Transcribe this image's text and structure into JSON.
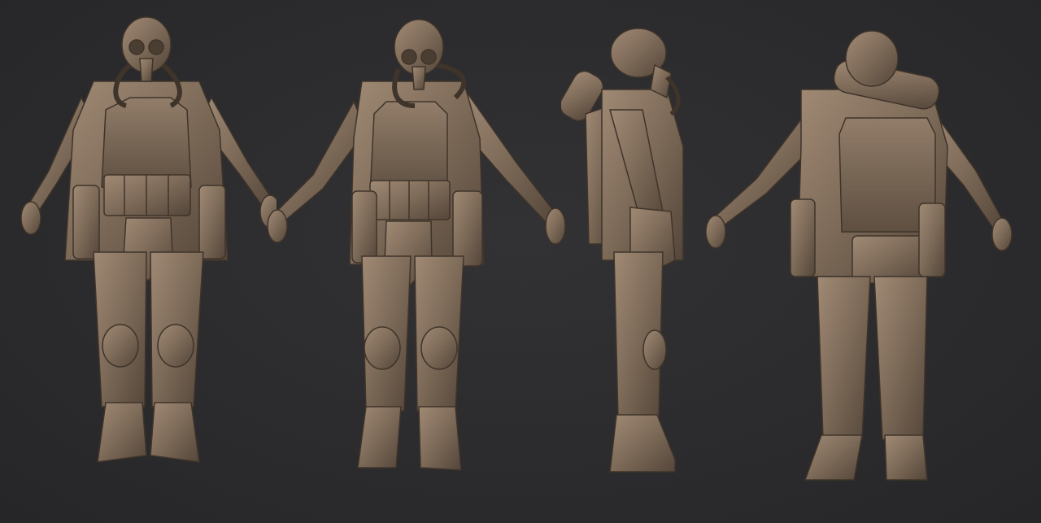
{
  "scene": {
    "background_color": "#2c2c2e",
    "clay_color": "#7d6a58",
    "clay_light": "#9a8571",
    "clay_dark": "#4e4034",
    "views": [
      {
        "name": "front-view"
      },
      {
        "name": "three-quarter-view"
      },
      {
        "name": "side-view"
      },
      {
        "name": "back-view"
      }
    ]
  }
}
